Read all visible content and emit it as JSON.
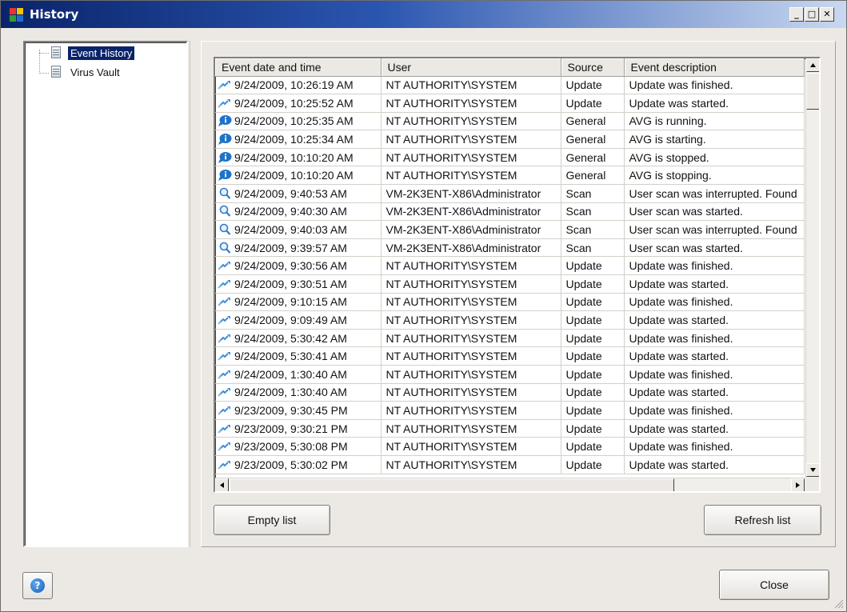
{
  "window": {
    "title": "History",
    "minimize_glyph": "_",
    "maximize_glyph": "□",
    "close_glyph": "✕"
  },
  "tree": {
    "items": [
      {
        "label": "Event History",
        "selected": true,
        "icon": "document-icon"
      },
      {
        "label": "Virus Vault",
        "selected": false,
        "icon": "document-icon"
      }
    ]
  },
  "table": {
    "columns": [
      "Event date and time",
      "User",
      "Source",
      "Event description"
    ],
    "rows": [
      {
        "icon": "update-icon",
        "time": "9/24/2009, 10:26:19 AM",
        "user": "NT AUTHORITY\\SYSTEM",
        "source": "Update",
        "desc": "Update was finished."
      },
      {
        "icon": "update-icon",
        "time": "9/24/2009, 10:25:52 AM",
        "user": "NT AUTHORITY\\SYSTEM",
        "source": "Update",
        "desc": "Update was started."
      },
      {
        "icon": "info-bubble-icon",
        "time": "9/24/2009, 10:25:35 AM",
        "user": "NT AUTHORITY\\SYSTEM",
        "source": "General",
        "desc": "AVG is running."
      },
      {
        "icon": "info-bubble-icon",
        "time": "9/24/2009, 10:25:34 AM",
        "user": "NT AUTHORITY\\SYSTEM",
        "source": "General",
        "desc": "AVG is starting."
      },
      {
        "icon": "info-bubble-icon",
        "time": "9/24/2009, 10:10:20 AM",
        "user": "NT AUTHORITY\\SYSTEM",
        "source": "General",
        "desc": "AVG is stopped."
      },
      {
        "icon": "info-bubble-icon",
        "time": "9/24/2009, 10:10:20 AM",
        "user": "NT AUTHORITY\\SYSTEM",
        "source": "General",
        "desc": "AVG is stopping."
      },
      {
        "icon": "magnifier-icon",
        "time": "9/24/2009, 9:40:53 AM",
        "user": "VM-2K3ENT-X86\\Administrator",
        "source": "Scan",
        "desc": "User scan was interrupted. Found"
      },
      {
        "icon": "magnifier-icon",
        "time": "9/24/2009, 9:40:30 AM",
        "user": "VM-2K3ENT-X86\\Administrator",
        "source": "Scan",
        "desc": "User scan was started."
      },
      {
        "icon": "magnifier-icon",
        "time": "9/24/2009, 9:40:03 AM",
        "user": "VM-2K3ENT-X86\\Administrator",
        "source": "Scan",
        "desc": "User scan was interrupted. Found"
      },
      {
        "icon": "magnifier-icon",
        "time": "9/24/2009, 9:39:57 AM",
        "user": "VM-2K3ENT-X86\\Administrator",
        "source": "Scan",
        "desc": "User scan was started."
      },
      {
        "icon": "update-icon",
        "time": "9/24/2009, 9:30:56 AM",
        "user": "NT AUTHORITY\\SYSTEM",
        "source": "Update",
        "desc": "Update was finished."
      },
      {
        "icon": "update-icon",
        "time": "9/24/2009, 9:30:51 AM",
        "user": "NT AUTHORITY\\SYSTEM",
        "source": "Update",
        "desc": "Update was started."
      },
      {
        "icon": "update-icon",
        "time": "9/24/2009, 9:10:15 AM",
        "user": "NT AUTHORITY\\SYSTEM",
        "source": "Update",
        "desc": "Update was finished."
      },
      {
        "icon": "update-icon",
        "time": "9/24/2009, 9:09:49 AM",
        "user": "NT AUTHORITY\\SYSTEM",
        "source": "Update",
        "desc": "Update was started."
      },
      {
        "icon": "update-icon",
        "time": "9/24/2009, 5:30:42 AM",
        "user": "NT AUTHORITY\\SYSTEM",
        "source": "Update",
        "desc": "Update was finished."
      },
      {
        "icon": "update-icon",
        "time": "9/24/2009, 5:30:41 AM",
        "user": "NT AUTHORITY\\SYSTEM",
        "source": "Update",
        "desc": "Update was started."
      },
      {
        "icon": "update-icon",
        "time": "9/24/2009, 1:30:40 AM",
        "user": "NT AUTHORITY\\SYSTEM",
        "source": "Update",
        "desc": "Update was finished."
      },
      {
        "icon": "update-icon",
        "time": "9/24/2009, 1:30:40 AM",
        "user": "NT AUTHORITY\\SYSTEM",
        "source": "Update",
        "desc": "Update was started."
      },
      {
        "icon": "update-icon",
        "time": "9/23/2009, 9:30:45 PM",
        "user": "NT AUTHORITY\\SYSTEM",
        "source": "Update",
        "desc": "Update was finished."
      },
      {
        "icon": "update-icon",
        "time": "9/23/2009, 9:30:21 PM",
        "user": "NT AUTHORITY\\SYSTEM",
        "source": "Update",
        "desc": "Update was started."
      },
      {
        "icon": "update-icon",
        "time": "9/23/2009, 5:30:08 PM",
        "user": "NT AUTHORITY\\SYSTEM",
        "source": "Update",
        "desc": "Update was finished."
      },
      {
        "icon": "update-icon",
        "time": "9/23/2009, 5:30:02 PM",
        "user": "NT AUTHORITY\\SYSTEM",
        "source": "Update",
        "desc": "Update was started."
      }
    ]
  },
  "buttons": {
    "empty_list": "Empty list",
    "refresh_list": "Refresh list",
    "close": "Close",
    "help_glyph": "?"
  },
  "colors": {
    "titlebar_start": "#0a246a",
    "titlebar_end": "#c9d8f0",
    "selection": "#0a246a",
    "icon_blue": "#1e73c8"
  }
}
